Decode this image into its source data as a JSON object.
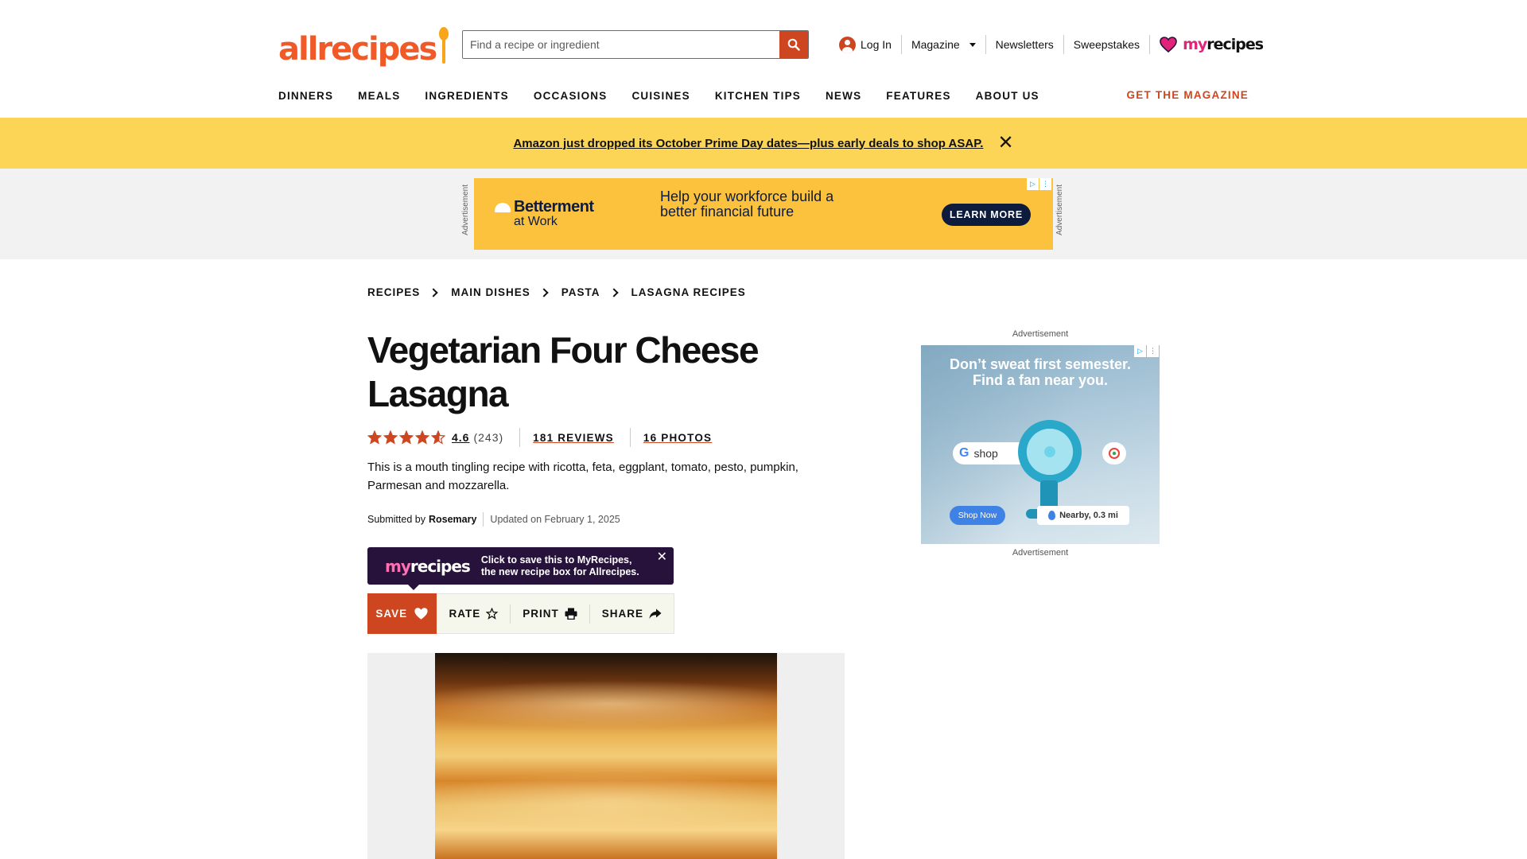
{
  "header": {
    "logo_text": "allrecipes",
    "search_placeholder": "Find a recipe or ingredient",
    "login_label": "Log In",
    "magazine_label": "Magazine",
    "newsletters_label": "Newsletters",
    "sweepstakes_label": "Sweepstakes",
    "myrecipes_my": "my",
    "myrecipes_recipes": "recipes",
    "brand_color": "#ce4620"
  },
  "nav": {
    "items": [
      "DINNERS",
      "MEALS",
      "INGREDIENTS",
      "OCCASIONS",
      "CUISINES",
      "KITCHEN TIPS",
      "NEWS",
      "FEATURES",
      "ABOUT US"
    ],
    "cta": "GET THE MAGAZINE"
  },
  "promo": {
    "text": "Amazon just dropped its October Prime Day dates—plus early deals to shop ASAP.",
    "close": "✕",
    "background": "#fcd557"
  },
  "leaderboard_ad": {
    "side_label": "Advertisement",
    "brand": "Betterment",
    "brand_sub": "at Work",
    "headline": "Help your workforce build a better financial future",
    "cta": "LEARN MORE",
    "background": "#fcc23d"
  },
  "breadcrumb": [
    "RECIPES",
    "MAIN DISHES",
    "PASTA",
    "LASAGNA RECIPES"
  ],
  "recipe": {
    "title": "Vegetarian Four Cheese Lasagna",
    "rating": 4.6,
    "rating_label": "4.6",
    "rating_count": "(243)",
    "reviews_link": "181 REVIEWS",
    "photos_link": "16 PHOTOS",
    "description": "This is a mouth tingling recipe with ricotta, feta, eggplant, tomato, pesto, pumpkin, Parmesan and mozzarella.",
    "submitted_by_label": "Submitted by",
    "author": "Rosemary",
    "updated": "Updated on February 1, 2025"
  },
  "myrecipes_tip": {
    "logo_my": "my",
    "logo_recipes": "recipes",
    "line1": "Click to save this to MyRecipes,",
    "line2": "the new recipe box for Allrecipes.",
    "close": "✕"
  },
  "actions": {
    "save": "SAVE",
    "rate": "RATE",
    "print": "PRINT",
    "share": "SHARE"
  },
  "rail_ad": {
    "label_top": "Advertisement",
    "label_bottom": "Advertisement",
    "headline_line1": "Don’t sweat first semester.",
    "headline_line2": "Find a fan near you.",
    "shop_pill": "shop",
    "shop_now": "Shop Now",
    "nearby": "Nearby, 0.3 mi"
  }
}
